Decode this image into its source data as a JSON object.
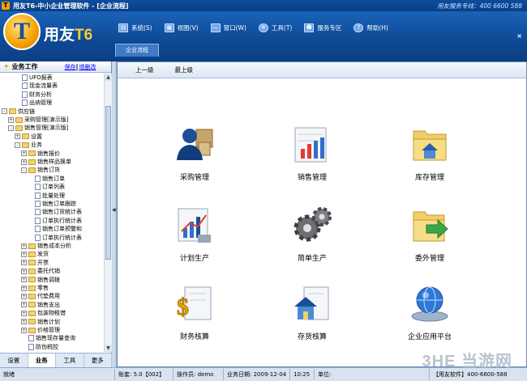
{
  "window": {
    "title": "用友T6-中小企业管理软件 - [企业流程]",
    "hotline": "用友服务专线：400 6600 588",
    "close_label": "×"
  },
  "logo": {
    "mark": "T",
    "text_main": "用友",
    "text_accent": "T6"
  },
  "menu": [
    {
      "label": "系统(S)",
      "icon": "system-icon"
    },
    {
      "label": "视图(V)",
      "icon": "view-icon"
    },
    {
      "label": "窗口(W)",
      "icon": "window-icon"
    },
    {
      "label": "工具(T)",
      "icon": "tools-icon"
    },
    {
      "label": "服务专区",
      "icon": "service-icon"
    },
    {
      "label": "帮助(H)",
      "icon": "help-icon"
    }
  ],
  "doc_tab": "企业流程",
  "left_panel": {
    "title": "业务工作",
    "save_link": "保存",
    "add_link": "增删改",
    "tree": [
      {
        "label": "UFO报表",
        "level": 2,
        "kind": "doc"
      },
      {
        "label": "现金流量表",
        "level": 2,
        "kind": "doc"
      },
      {
        "label": "财务分析",
        "level": 2,
        "kind": "doc"
      },
      {
        "label": "出纳管理",
        "level": 2,
        "kind": "doc"
      },
      {
        "label": "供应链",
        "level": 0,
        "kind": "folder",
        "toggle": "-"
      },
      {
        "label": "采购管理[演示版]",
        "level": 1,
        "kind": "folder",
        "toggle": "+"
      },
      {
        "label": "销售管理[演示版]",
        "level": 1,
        "kind": "folder",
        "toggle": "-"
      },
      {
        "label": "设置",
        "level": 2,
        "kind": "folder",
        "toggle": "+"
      },
      {
        "label": "业务",
        "level": 2,
        "kind": "folder",
        "toggle": "-"
      },
      {
        "label": "销售报价",
        "level": 3,
        "kind": "folder",
        "toggle": "+"
      },
      {
        "label": "销售样品换单",
        "level": 3,
        "kind": "folder",
        "toggle": "+"
      },
      {
        "label": "销售订货",
        "level": 3,
        "kind": "folder",
        "toggle": "-"
      },
      {
        "label": "销售订单",
        "level": 4,
        "kind": "doc"
      },
      {
        "label": "订单列表",
        "level": 4,
        "kind": "doc"
      },
      {
        "label": "批量处理",
        "level": 4,
        "kind": "doc"
      },
      {
        "label": "销售订单跟踪",
        "level": 4,
        "kind": "doc"
      },
      {
        "label": "销售订货统计表",
        "level": 4,
        "kind": "doc"
      },
      {
        "label": "订单执行统计表",
        "level": 4,
        "kind": "doc"
      },
      {
        "label": "销售订单预警和",
        "level": 4,
        "kind": "doc"
      },
      {
        "label": "订单执行统计表",
        "level": 4,
        "kind": "doc"
      },
      {
        "label": "销售成本分析",
        "level": 3,
        "kind": "folder",
        "toggle": "+"
      },
      {
        "label": "发货",
        "level": 3,
        "kind": "folder",
        "toggle": "+"
      },
      {
        "label": "开票",
        "level": 3,
        "kind": "folder",
        "toggle": "+"
      },
      {
        "label": "委托代销",
        "level": 3,
        "kind": "folder",
        "toggle": "+"
      },
      {
        "label": "销售调拨",
        "level": 3,
        "kind": "folder",
        "toggle": "+"
      },
      {
        "label": "零售",
        "level": 3,
        "kind": "folder",
        "toggle": "+"
      },
      {
        "label": "代垫费用",
        "level": 3,
        "kind": "folder",
        "toggle": "+"
      },
      {
        "label": "销售支出",
        "level": 3,
        "kind": "folder",
        "toggle": "+"
      },
      {
        "label": "包装物租借",
        "level": 3,
        "kind": "folder",
        "toggle": "+"
      },
      {
        "label": "销售计划",
        "level": 3,
        "kind": "folder",
        "toggle": "+"
      },
      {
        "label": "价格管理",
        "level": 3,
        "kind": "folder",
        "toggle": "+"
      },
      {
        "label": "销售现存量查询",
        "level": 3,
        "kind": "doc"
      },
      {
        "label": "防伪税控",
        "level": 3,
        "kind": "doc"
      }
    ],
    "tabs": [
      "设置",
      "业务",
      "工具",
      "更多"
    ]
  },
  "nav": {
    "up": "上一级",
    "top": "最上级"
  },
  "modules": [
    {
      "label": "采购管理",
      "icon": "purchase-user-icon"
    },
    {
      "label": "销售管理",
      "icon": "sales-chart-icon"
    },
    {
      "label": "库存管理",
      "icon": "inventory-house-folder-icon"
    },
    {
      "label": "计划生产",
      "icon": "plan-chart-icon"
    },
    {
      "label": "简单生产",
      "icon": "gears-icon"
    },
    {
      "label": "委外管理",
      "icon": "outsource-arrow-folder-icon"
    },
    {
      "label": "财务核算",
      "icon": "finance-dollar-icon"
    },
    {
      "label": "存货核算",
      "icon": "stock-house-doc-icon"
    },
    {
      "label": "企业应用平台",
      "icon": "platform-globe-icon"
    }
  ],
  "status": {
    "ready": "就绪",
    "account": "账套: 5.0【002】",
    "operator": "操作员: demo",
    "date": "业务日期: 2009-12-04",
    "time": "10:25",
    "unit": "单位:",
    "vendor": "【用友软件】400-6600-588"
  },
  "watermark": "3HE 当游网",
  "colors": {
    "header_blue": "#0e4a97",
    "accent_gold": "#f4a000",
    "panel_bg": "#ffffff"
  }
}
